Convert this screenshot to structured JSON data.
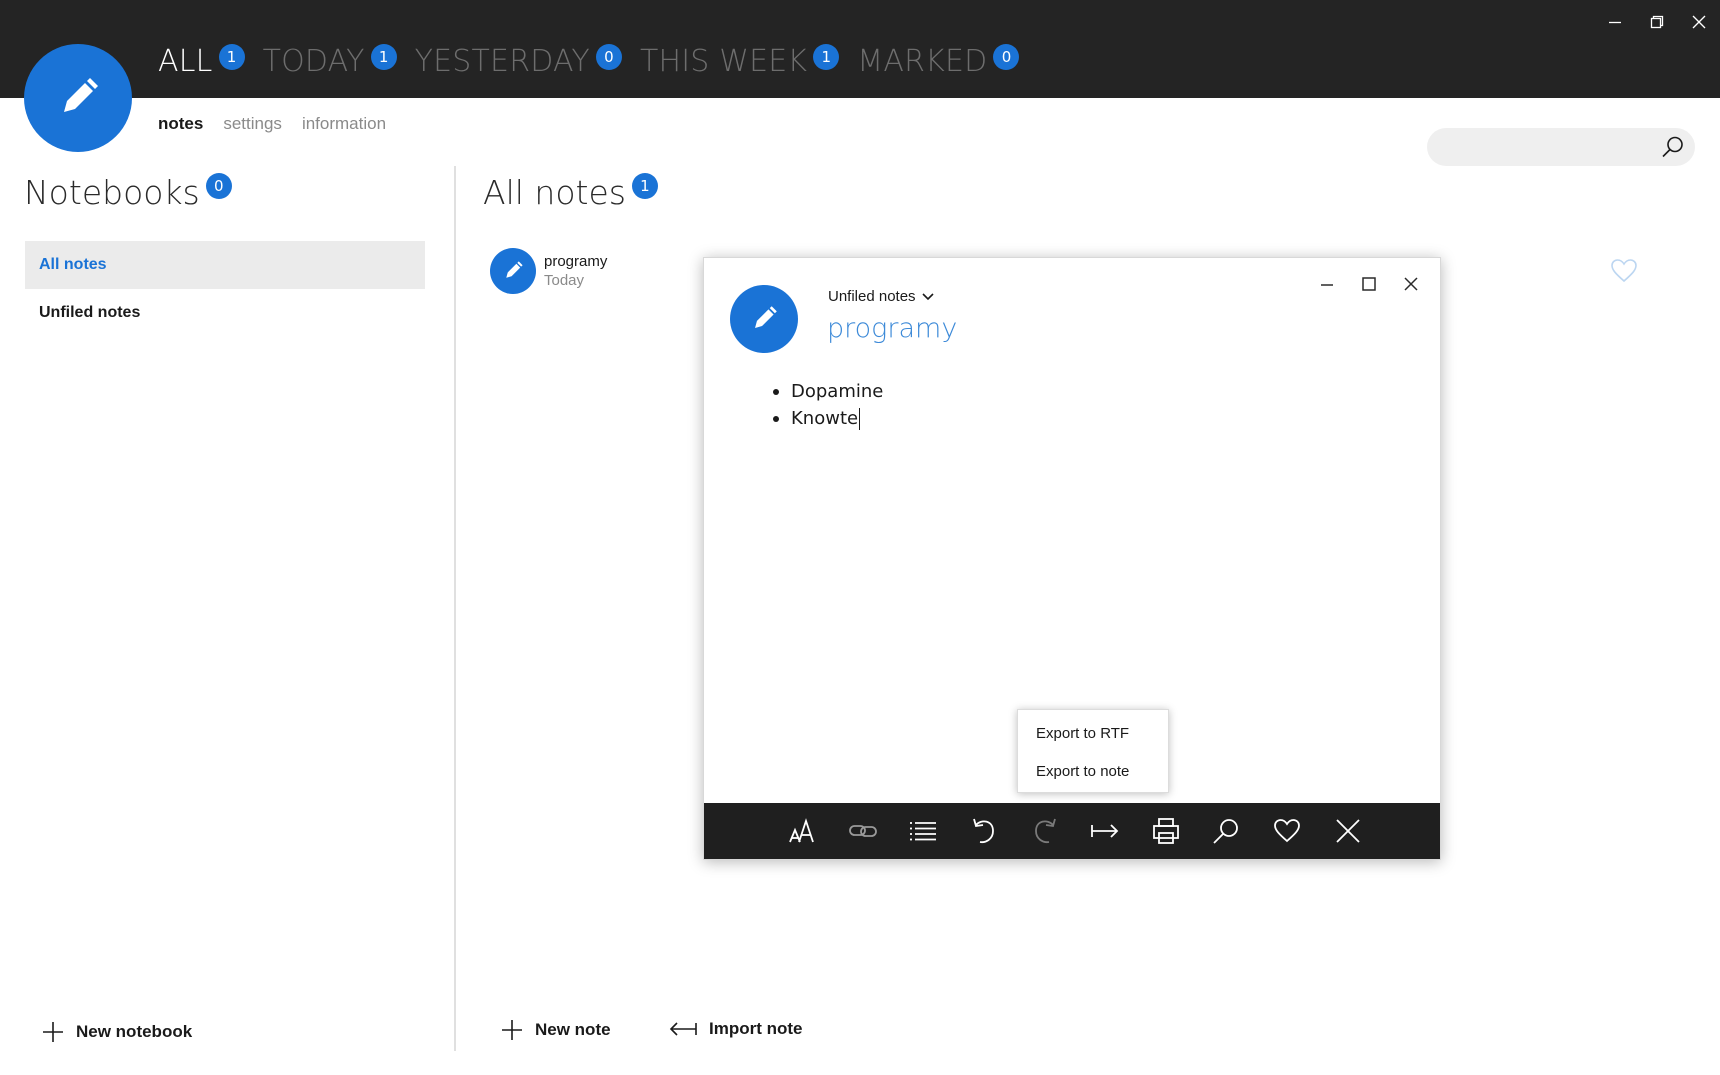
{
  "header": {
    "filters": [
      {
        "label": "ALL",
        "count": "1",
        "active": true
      },
      {
        "label": "TODAY",
        "count": "1",
        "active": false
      },
      {
        "label": "YESTERDAY",
        "count": "0",
        "active": false
      },
      {
        "label": "THIS WEEK",
        "count": "1",
        "active": false
      },
      {
        "label": "MARKED",
        "count": "0",
        "active": false
      }
    ],
    "subnav": [
      {
        "label": "notes",
        "active": true
      },
      {
        "label": "settings",
        "active": false
      },
      {
        "label": "information",
        "active": false
      }
    ],
    "search_value": "",
    "accent_color": "#1a73d6",
    "bar_color": "#242424"
  },
  "notebooks": {
    "title": "Notebooks",
    "count": "0",
    "items": [
      {
        "label": "All notes",
        "selected": true
      },
      {
        "label": "Unfiled notes",
        "selected": false
      }
    ],
    "new_label": "New notebook"
  },
  "notes": {
    "title": "All notes",
    "count": "1",
    "items": [
      {
        "title": "programy",
        "date": "Today",
        "icon": "pencil-icon"
      }
    ],
    "new_label": "New note",
    "import_label": "Import note"
  },
  "editor": {
    "notebook": "Unfiled notes",
    "title": "programy",
    "lines": [
      "Dopamine",
      "Knowte"
    ],
    "context_menu": [
      "Export to RTF",
      "Export to note"
    ],
    "toolbar": [
      "font-size-icon",
      "link-icon",
      "list-icon",
      "undo-icon",
      "redo-icon",
      "indent-icon",
      "print-icon",
      "search-icon",
      "heart-icon",
      "close-icon"
    ]
  }
}
